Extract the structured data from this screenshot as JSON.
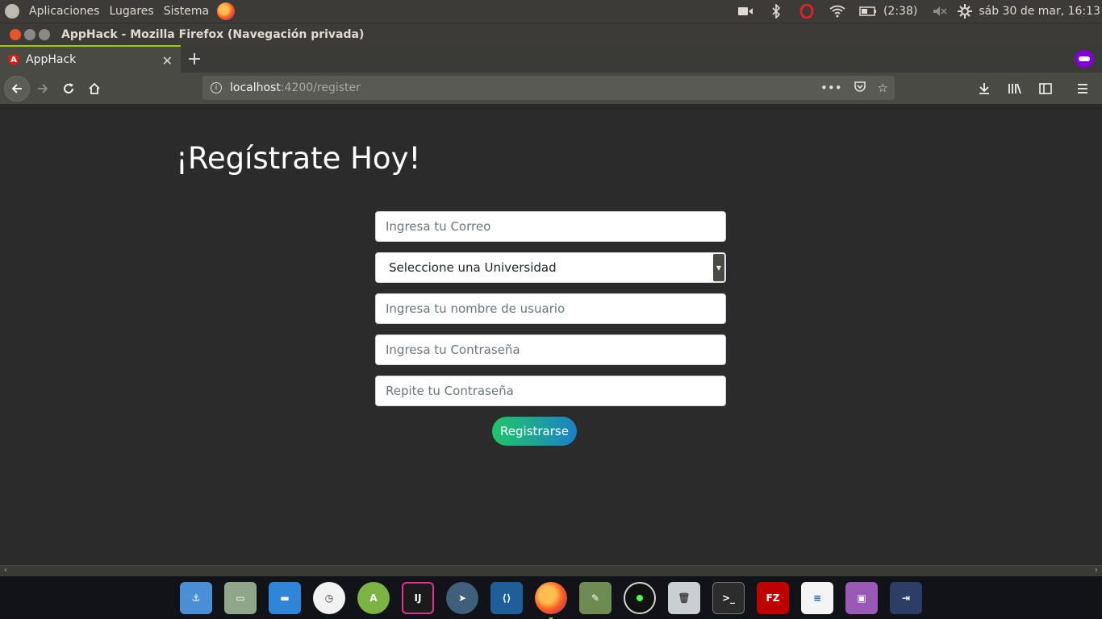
{
  "top_panel": {
    "menus": [
      "Aplicaciones",
      "Lugares",
      "Sistema"
    ],
    "battery_time": "(2:38)",
    "datetime": "sáb 30 de mar, 16:13"
  },
  "window": {
    "title": "AppHack - Mozilla Firefox (Navegación privada)"
  },
  "tabs": [
    {
      "label": "AppHack",
      "icon": "angular-icon"
    }
  ],
  "urlbar": {
    "host": "localhost",
    "path": ":4200/register"
  },
  "page": {
    "title": "¡Regístrate Hoy!",
    "email_placeholder": "Ingresa tu Correo",
    "university_selected": "Seleccione una Universidad",
    "username_placeholder": "Ingresa tu nombre de usuario",
    "password_placeholder": "Ingresa tu Contraseña",
    "password_repeat_placeholder": "Repite tu Contraseña",
    "submit_label": "Registrarse"
  },
  "colors": {
    "page_bg": "#2b2b2b",
    "button_gradient_start": "#1fc46b",
    "button_gradient_end": "#1a7fc8",
    "tab_accent": "#9ccc00"
  },
  "dock": {
    "items": [
      "anchor-icon",
      "archive-manager-icon",
      "files-icon",
      "clock-icon",
      "android-studio-icon",
      "intellij-icon",
      "telegram-icon",
      "vscode-icon",
      "firefox-icon",
      "tools-icon",
      "radar-icon",
      "trash-icon",
      "terminal-icon",
      "filezilla-icon",
      "writer-icon",
      "video-icon",
      "code-tool-icon"
    ]
  }
}
